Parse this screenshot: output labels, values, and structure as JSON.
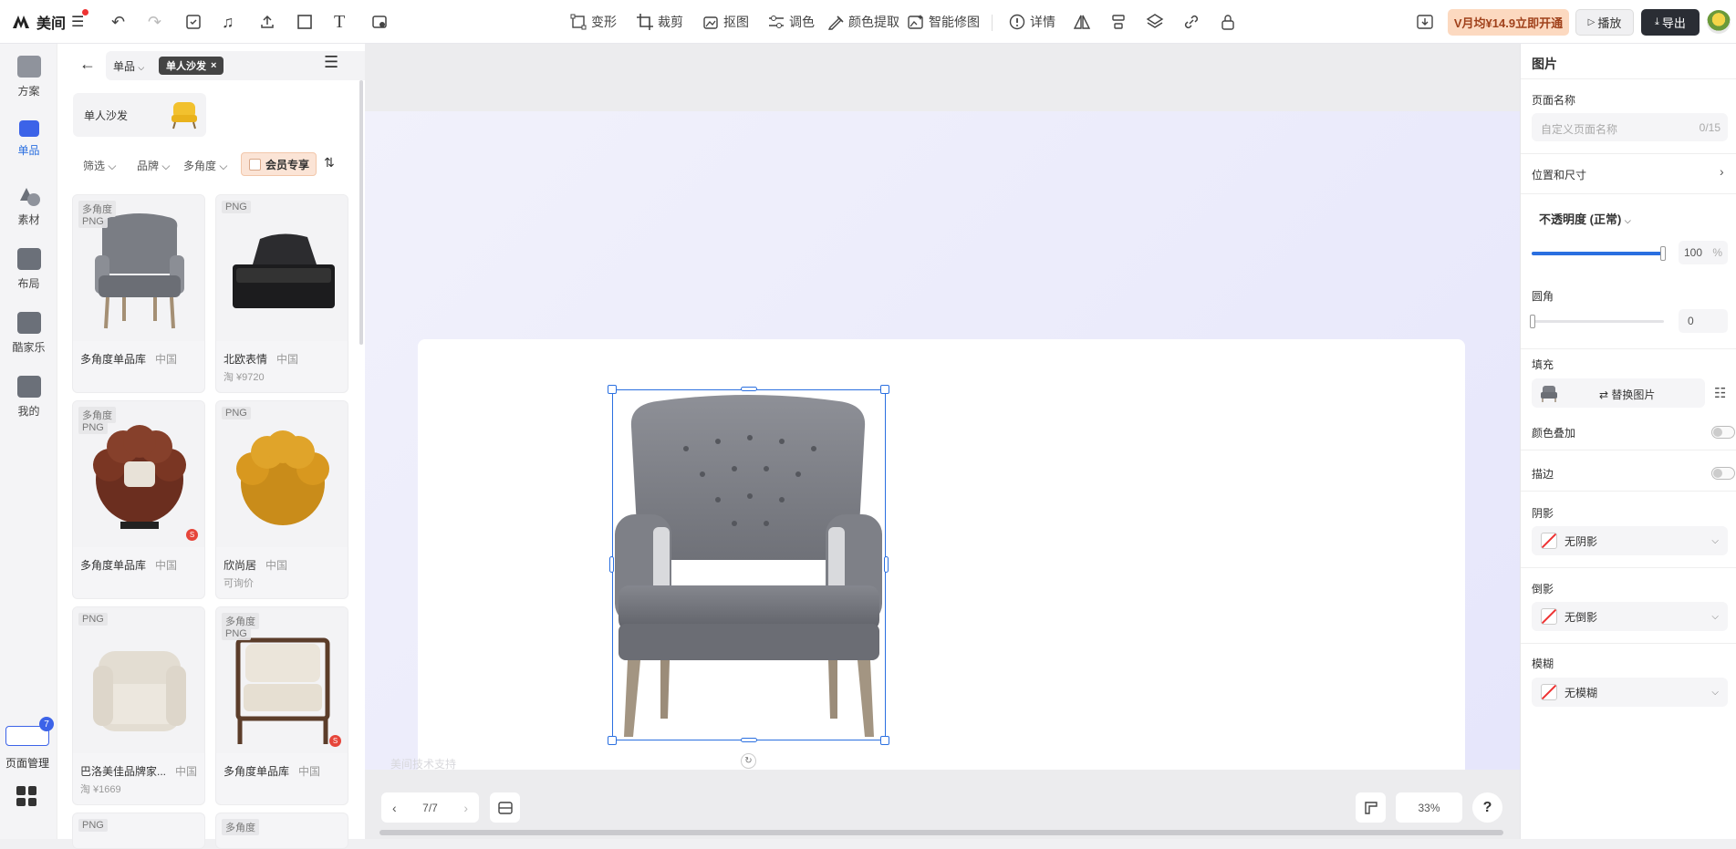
{
  "app": {
    "logo_text": "美间"
  },
  "toolbar": {
    "transform": "变形",
    "crop": "裁剪",
    "cutout": "抠图",
    "adjust": "调色",
    "color_extract": "颜色提取",
    "smart_edit": "智能修图",
    "details": "详情",
    "vip_offer": "V月均¥14.9立即开通",
    "play": "播放",
    "export": "导出"
  },
  "leftnav": {
    "items": [
      {
        "label": "方案"
      },
      {
        "label": "单品"
      },
      {
        "label": "素材"
      },
      {
        "label": "布局"
      },
      {
        "label": "酷家乐"
      },
      {
        "label": "我的"
      }
    ],
    "page_mgmt": "页面管理",
    "page_badge": "7"
  },
  "panel": {
    "category_select": "单品",
    "active_tag": "单人沙发",
    "category_card_label": "单人沙发",
    "filters": {
      "filter": "筛选",
      "brand": "品牌",
      "angle": "多角度",
      "member": "会员专享"
    },
    "products": [
      {
        "badges": [
          "多角度",
          "PNG"
        ],
        "name": "多角度单品库",
        "origin": "中国",
        "price": ""
      },
      {
        "badges": [
          "PNG"
        ],
        "name": "北欧表情",
        "origin": "中国",
        "price": "淘 ¥9720"
      },
      {
        "badges": [
          "多角度",
          "PNG"
        ],
        "name": "多角度单品库",
        "origin": "中国",
        "price": ""
      },
      {
        "badges": [
          "PNG"
        ],
        "name": "欣尚居",
        "origin": "中国",
        "price": "可询价"
      },
      {
        "badges": [
          "PNG"
        ],
        "name": "巴洛美佳品牌家...",
        "origin": "中国",
        "price": "淘 ¥1669"
      },
      {
        "badges": [
          "多角度",
          "PNG"
        ],
        "name": "多角度单品库",
        "origin": "中国",
        "price": ""
      },
      {
        "badges": [
          "PNG"
        ],
        "name": "",
        "origin": "",
        "price": ""
      },
      {
        "badges": [
          "多角度"
        ],
        "name": "",
        "origin": "",
        "price": ""
      }
    ]
  },
  "canvas": {
    "watermark": "美间技术支持",
    "page_indicator": "7/7",
    "zoom": "33%",
    "help": "?"
  },
  "rightpanel": {
    "title": "图片",
    "page_name_label": "页面名称",
    "page_name_placeholder": "自定义页面名称",
    "page_name_count": "0/15",
    "position_size": "位置和尺寸",
    "opacity_label": "不透明度 (正常)",
    "opacity_value": "100",
    "opacity_unit": "%",
    "opacity_fraction": 1.0,
    "corner_label": "圆角",
    "corner_value": "0",
    "fill_label": "填充",
    "replace_image": "⇄ 替换图片",
    "color_overlay": "颜色叠加",
    "stroke": "描边",
    "shadow_label": "阴影",
    "shadow_value": "无阴影",
    "reflection_label": "倒影",
    "reflection_value": "无倒影",
    "blur_label": "模糊",
    "blur_value": "无模糊"
  }
}
